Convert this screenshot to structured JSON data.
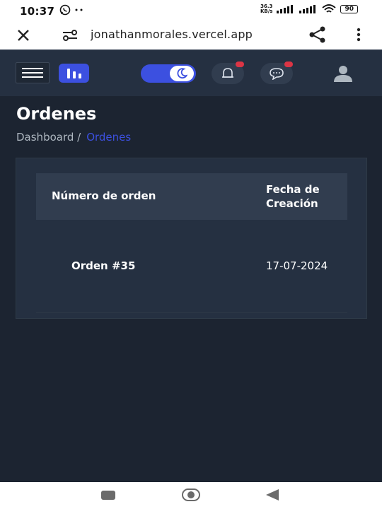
{
  "status_bar": {
    "time": "10:37",
    "net_speed_value": "36.3",
    "net_speed_unit": "KB/s",
    "battery": "90"
  },
  "browser": {
    "url": "jonathanmorales.vercel.app",
    "icons": [
      "close-icon",
      "site-settings-icon",
      "share-icon",
      "more-vert-icon"
    ]
  },
  "header": {
    "icons": [
      "hamburger-icon",
      "app-logo-icon",
      "moon-icon",
      "bell-icon",
      "chat-icon",
      "user-avatar-icon"
    ],
    "accent_color": "#3c50e0",
    "notification_color": "#dc3545"
  },
  "page": {
    "title": "Ordenes",
    "breadcrumb": {
      "parent": "Dashboard /",
      "current": "Ordenes"
    }
  },
  "table": {
    "headers": {
      "order_number": "Número de orden",
      "created_line1": "Fecha de",
      "created_line2": "Creación"
    },
    "rows": [
      {
        "order": "Orden #35",
        "date": "17-07-2024"
      }
    ]
  }
}
